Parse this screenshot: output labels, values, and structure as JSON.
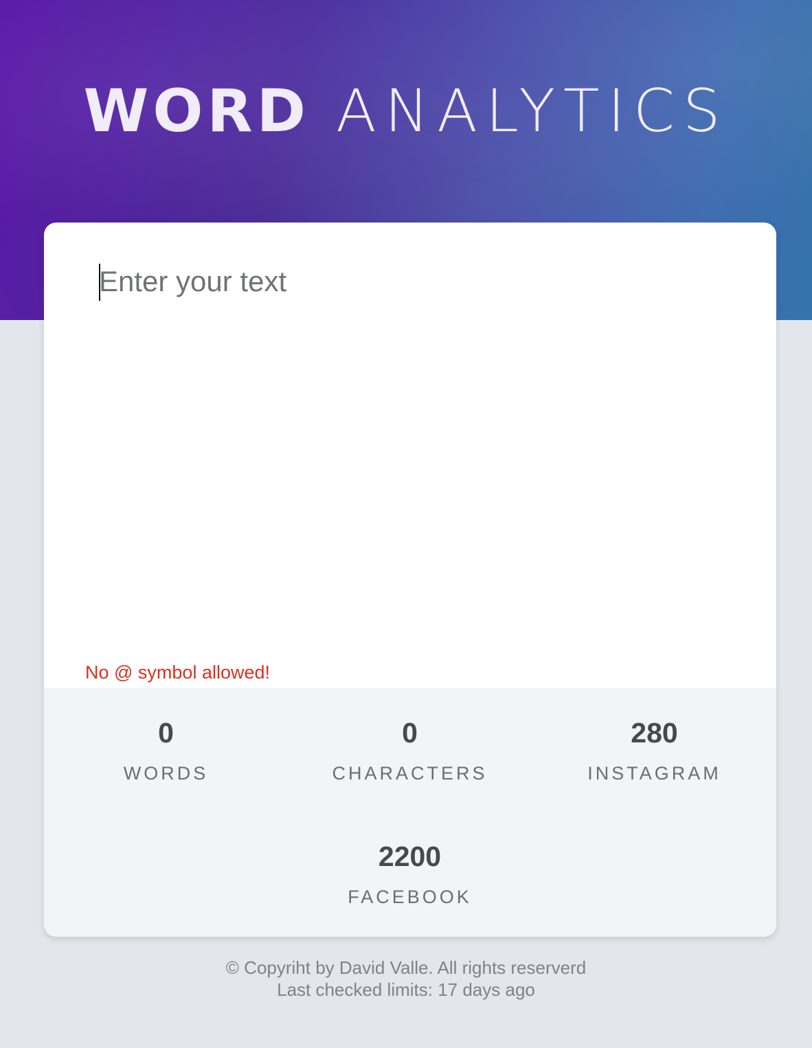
{
  "header": {
    "title_bold": "WORD",
    "title_light": "ANALYTICS"
  },
  "editor": {
    "placeholder": "Enter your text",
    "value": "",
    "warning": "No @ symbol allowed!"
  },
  "stats": {
    "words": {
      "value": "0",
      "label": "WORDS"
    },
    "characters": {
      "value": "0",
      "label": "CHARACTERS"
    },
    "instagram": {
      "value": "280",
      "label": "INSTAGRAM"
    },
    "facebook": {
      "value": "2200",
      "label": "FACEBOOK"
    }
  },
  "footer": {
    "copyright": "© Copyriht by David Valle. All rights reserverd",
    "last_checked": "Last checked limits: 17 days ago"
  },
  "colors": {
    "warning": "#dc2f1f",
    "page_background": "#e3e7eb",
    "stats_background": "#f1f5f8"
  }
}
